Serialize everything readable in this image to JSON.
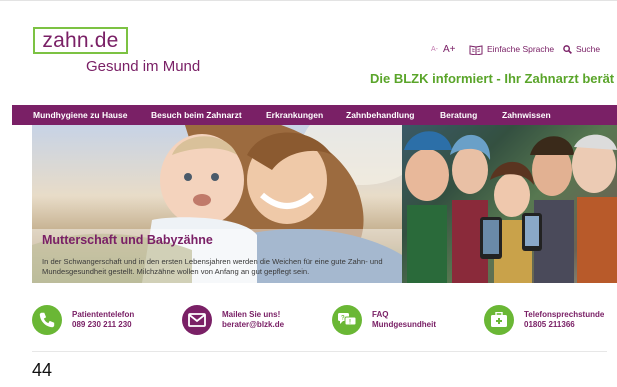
{
  "header": {
    "logo_text": "zahn.de",
    "tagline": "Gesund im Mund",
    "slogan": "Die BLZK informiert - Ihr Zahnarzt berät",
    "font_small": "A-",
    "font_large": "A+",
    "simple_language": "Einfache Sprache",
    "search": "Suche"
  },
  "nav": {
    "items": [
      {
        "label": "Mundhygiene zu Hause"
      },
      {
        "label": "Besuch beim Zahnarzt"
      },
      {
        "label": "Erkrankungen"
      },
      {
        "label": "Zahnbehandlung"
      },
      {
        "label": "Beratung"
      },
      {
        "label": "Zahnwissen"
      }
    ]
  },
  "hero": {
    "title": "Mutterschaft und Babyzähne",
    "text": "In der Schwangerschaft und in den ersten Lebensjahren werden die Weichen für eine gute Zahn- und Mundesgesundheit gestellt. Milchzähne wollen von Anfang an gut gepflegt sein."
  },
  "contacts": [
    {
      "line1": "Patiententelefon",
      "line2": "089 230 211 230",
      "icon": "phone-icon"
    },
    {
      "line1": "Mailen Sie uns!",
      "line2": "berater@blzk.de",
      "icon": "mail-icon"
    },
    {
      "line1": "FAQ",
      "line2": "Mundgesundheit",
      "icon": "faq-icon"
    },
    {
      "line1": "Telefonsprechstunde",
      "line2": "01805 211366",
      "icon": "medical-kit-icon"
    }
  ],
  "page_number": "44",
  "colors": {
    "brand_purple": "#7a2066",
    "brand_green": "#6ab735",
    "slogan_green": "#5aa52a"
  }
}
